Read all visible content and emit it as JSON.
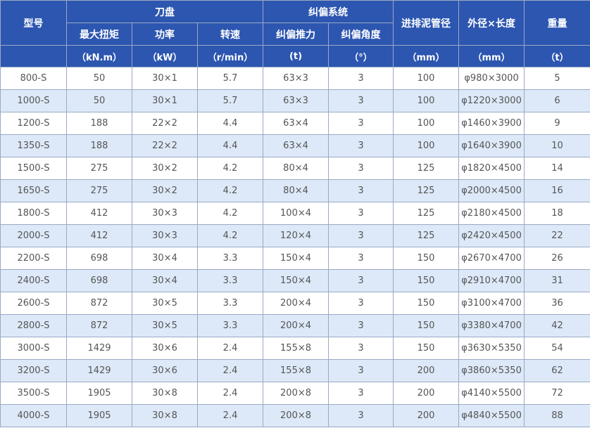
{
  "headers": {
    "model": "型号",
    "cutterhead": "刀盘",
    "correction_system": "纠偏系统",
    "slurry_pipe": "进排泥管径",
    "dimensions": "外径×长度",
    "weight": "重量",
    "max_torque": "最大扭矩",
    "power": "功率",
    "speed": "转速",
    "correction_thrust": "纠偏推力",
    "correction_angle": "纠偏角度",
    "unit_torque": "（kN.m）",
    "unit_power": "（kW）",
    "unit_speed": "（r/min）",
    "unit_thrust": "(t)",
    "unit_angle": "（°）",
    "unit_pipe": "（mm）",
    "unit_dim": "（mm）",
    "unit_weight": "（t）"
  },
  "rows": [
    {
      "model": "800-S",
      "torque": "50",
      "power": "30×1",
      "speed": "5.7",
      "thrust": "63×3",
      "angle": "3",
      "pipe": "100",
      "dim": "φ980×3000",
      "weight": "5"
    },
    {
      "model": "1000-S",
      "torque": "50",
      "power": "30×1",
      "speed": "5.7",
      "thrust": "63×3",
      "angle": "3",
      "pipe": "100",
      "dim": "φ1220×3000",
      "weight": "6"
    },
    {
      "model": "1200-S",
      "torque": "188",
      "power": "22×2",
      "speed": "4.4",
      "thrust": "63×4",
      "angle": "3",
      "pipe": "100",
      "dim": "φ1460×3900",
      "weight": "9"
    },
    {
      "model": "1350-S",
      "torque": "188",
      "power": "22×2",
      "speed": "4.4",
      "thrust": "63×4",
      "angle": "3",
      "pipe": "100",
      "dim": "φ1640×3900",
      "weight": "10"
    },
    {
      "model": "1500-S",
      "torque": "275",
      "power": "30×2",
      "speed": "4.2",
      "thrust": "80×4",
      "angle": "3",
      "pipe": "125",
      "dim": "φ1820×4500",
      "weight": "14"
    },
    {
      "model": "1650-S",
      "torque": "275",
      "power": "30×2",
      "speed": "4.2",
      "thrust": "80×4",
      "angle": "3",
      "pipe": "125",
      "dim": "φ2000×4500",
      "weight": "16"
    },
    {
      "model": "1800-S",
      "torque": "412",
      "power": "30×3",
      "speed": "4.2",
      "thrust": "100×4",
      "angle": "3",
      "pipe": "125",
      "dim": "φ2180×4500",
      "weight": "18"
    },
    {
      "model": "2000-S",
      "torque": "412",
      "power": "30×3",
      "speed": "4.2",
      "thrust": "120×4",
      "angle": "3",
      "pipe": "125",
      "dim": "φ2420×4500",
      "weight": "22"
    },
    {
      "model": "2200-S",
      "torque": "698",
      "power": "30×4",
      "speed": "3.3",
      "thrust": "150×4",
      "angle": "3",
      "pipe": "150",
      "dim": "φ2670×4700",
      "weight": "26"
    },
    {
      "model": "2400-S",
      "torque": "698",
      "power": "30×4",
      "speed": "3.3",
      "thrust": "150×4",
      "angle": "3",
      "pipe": "150",
      "dim": "φ2910×4700",
      "weight": "31"
    },
    {
      "model": "2600-S",
      "torque": "872",
      "power": "30×5",
      "speed": "3.3",
      "thrust": "200×4",
      "angle": "3",
      "pipe": "150",
      "dim": "φ3100×4700",
      "weight": "36"
    },
    {
      "model": "2800-S",
      "torque": "872",
      "power": "30×5",
      "speed": "3.3",
      "thrust": "200×4",
      "angle": "3",
      "pipe": "150",
      "dim": "φ3380×4700",
      "weight": "42"
    },
    {
      "model": "3000-S",
      "torque": "1429",
      "power": "30×6",
      "speed": "2.4",
      "thrust": "155×8",
      "angle": "3",
      "pipe": "150",
      "dim": "φ3630×5350",
      "weight": "54"
    },
    {
      "model": "3200-S",
      "torque": "1429",
      "power": "30×6",
      "speed": "2.4",
      "thrust": "155×8",
      "angle": "3",
      "pipe": "200",
      "dim": "φ3860×5350",
      "weight": "62"
    },
    {
      "model": "3500-S",
      "torque": "1905",
      "power": "30×8",
      "speed": "2.4",
      "thrust": "200×8",
      "angle": "3",
      "pipe": "200",
      "dim": "φ4140×5500",
      "weight": "72"
    },
    {
      "model": "4000-S",
      "torque": "1905",
      "power": "30×8",
      "speed": "2.4",
      "thrust": "200×8",
      "angle": "3",
      "pipe": "200",
      "dim": "φ4840×5500",
      "weight": "88"
    }
  ],
  "colors": {
    "header_bg": "#2c56b0",
    "header_text": "#ffffff",
    "row_alt_bg": "#dde9f8",
    "row_bg": "#ffffff",
    "cell_text": "#555555",
    "border": "#9aa9c4"
  }
}
